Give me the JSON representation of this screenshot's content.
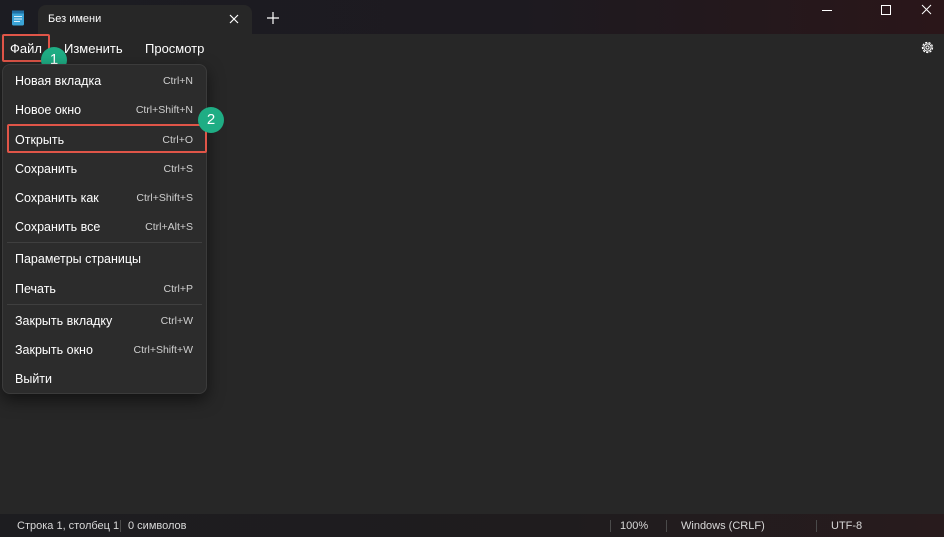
{
  "window": {
    "tab_title": "Без имени"
  },
  "menubar": {
    "items": [
      "Файл",
      "Изменить",
      "Просмотр"
    ]
  },
  "annotations": {
    "badge1": "1",
    "badge2": "2",
    "highlight_color": "#e05548",
    "badge_color": "#1fad84"
  },
  "file_menu": {
    "items": [
      {
        "label": "Новая вкладка",
        "shortcut": "Ctrl+N"
      },
      {
        "label": "Новое окно",
        "shortcut": "Ctrl+Shift+N"
      },
      {
        "label": "Открыть",
        "shortcut": "Ctrl+O"
      },
      {
        "label": "Сохранить",
        "shortcut": "Ctrl+S"
      },
      {
        "label": "Сохранить как",
        "shortcut": "Ctrl+Shift+S"
      },
      {
        "label": "Сохранить все",
        "shortcut": "Ctrl+Alt+S"
      },
      {
        "label": "Параметры страницы",
        "shortcut": ""
      },
      {
        "label": "Печать",
        "shortcut": "Ctrl+P"
      },
      {
        "label": "Закрыть вкладку",
        "shortcut": "Ctrl+W"
      },
      {
        "label": "Закрыть окно",
        "shortcut": "Ctrl+Shift+W"
      },
      {
        "label": "Выйти",
        "shortcut": ""
      }
    ]
  },
  "status": {
    "position": "Строка 1, столбец 1",
    "chars": "0 символов",
    "zoom": "100%",
    "line_endings": "Windows (CRLF)",
    "encoding": "UTF-8"
  },
  "icons": {
    "app": "notepad-icon",
    "close_tab": "close-icon",
    "new_tab": "plus-icon",
    "settings": "gear-icon"
  }
}
